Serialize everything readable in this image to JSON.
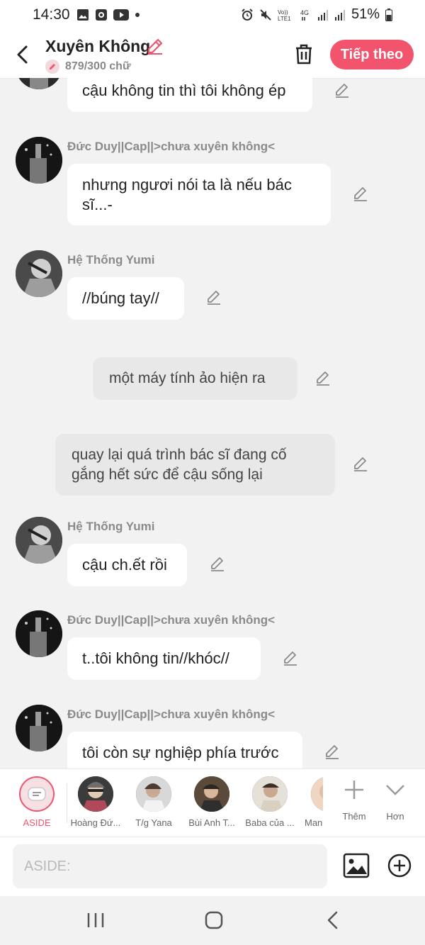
{
  "status_bar": {
    "time": "14:30",
    "left_icons": [
      "image-icon",
      "screen-record-icon",
      "youtube-icon",
      "dot-icon"
    ],
    "right_icons": [
      "alarm-icon",
      "mute-icon",
      "volte-icon",
      "4g-icon",
      "signal-icon",
      "signal-icon"
    ],
    "battery": "51%"
  },
  "header": {
    "title": "Xuyên Không",
    "word_count": "879/300 chữ",
    "next_label": "Tiếp theo",
    "accent_color": "#f2546d"
  },
  "messages": [
    {
      "type": "bubble",
      "sender": "",
      "text": "cậu không tin thì tôi không ép"
    },
    {
      "type": "bubble",
      "sender": "Đức Duy||Cap||>chưa xuyên không<",
      "text_line1": "nhưng ngươi nói ta là nếu bác",
      "text_line2": "sĩ...-"
    },
    {
      "type": "bubble",
      "sender": "Hệ Thống Yumi",
      "text": "//búng tay//"
    },
    {
      "type": "narration",
      "text": "một máy tính ảo hiện ra"
    },
    {
      "type": "narration",
      "text_line1": "quay lại quá trình bác sĩ đang cố",
      "text_line2": "gắng hết sức để cậu sống lại"
    },
    {
      "type": "bubble",
      "sender": "Hệ Thống Yumi",
      "text": "cậu ch.ết rồi"
    },
    {
      "type": "bubble",
      "sender": "Đức Duy||Cap||>chưa xuyên không<",
      "text": "t..tôi không tin//khóc//"
    },
    {
      "type": "bubble",
      "sender": "Đức Duy||Cap||>chưa xuyên không<",
      "text": "tôi còn sự nghiệp phía trước"
    }
  ],
  "characters": [
    {
      "label": "ASIDE",
      "selected": true
    },
    {
      "label": "Hoàng Đứ..."
    },
    {
      "label": "T/g Yana"
    },
    {
      "label": "Bùi Anh T..."
    },
    {
      "label": "Baba của ..."
    },
    {
      "label": "Man"
    }
  ],
  "tools": {
    "add_label": "Thêm",
    "more_label": "Hơn"
  },
  "input": {
    "placeholder": "ASIDE:"
  },
  "nav": [
    "recents-icon",
    "home-icon",
    "back-icon"
  ]
}
